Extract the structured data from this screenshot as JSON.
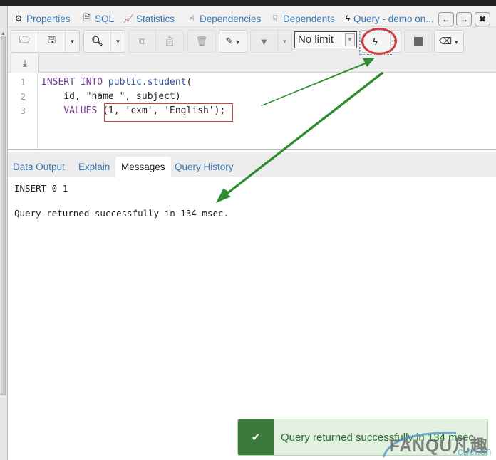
{
  "object_tabs": [
    {
      "label": "Properties",
      "icon": "gears-icon"
    },
    {
      "label": "SQL",
      "icon": "file-text-icon"
    },
    {
      "label": "Statistics",
      "icon": "line-chart-icon"
    },
    {
      "label": "Dependencies",
      "icon": "hand-up-icon"
    },
    {
      "label": "Dependents",
      "icon": "hand-down-icon"
    },
    {
      "label": "Query - demo on...",
      "icon": "bolt-icon"
    }
  ],
  "nav_buttons": {
    "back": "←",
    "forward": "→",
    "close": "✖"
  },
  "toolbar": {
    "open_file": "open-folder-icon",
    "save": "save-icon",
    "find": "search-icon",
    "copy": "copy-icon",
    "paste": "paste-icon",
    "delete": "trash-icon",
    "edit": "edit-icon",
    "filter": "filter-icon",
    "row_limit": "No limit",
    "execute": "bolt-icon",
    "stop": "stop-icon",
    "clear": "eraser-icon",
    "download": "download-icon"
  },
  "editor": {
    "line_numbers": [
      "1",
      "2",
      "3"
    ],
    "lines": {
      "l1_kw": "INSERT INTO ",
      "l1_obj": "public.student",
      "l1_rest": "(",
      "l2": "    id, \"name \", subject)",
      "l3_kw": "    VALUES ",
      "l3_rest": "(1, 'cxm', 'English');"
    }
  },
  "result_tabs": [
    {
      "label": "Data Output",
      "active": false
    },
    {
      "label": "Explain",
      "active": false
    },
    {
      "label": "Messages",
      "active": true
    },
    {
      "label": "Query History",
      "active": false
    }
  ],
  "messages": {
    "line1": "INSERT 0 1",
    "line2": "Query returned successfully in 134 msec."
  },
  "toast": {
    "text": "Query returned successfully in 134 msec.",
    "icon": "check-icon"
  },
  "watermark": {
    "main": "FANQU凡趣",
    "sub": "cuel.cn"
  },
  "annotation_colors": {
    "arrow": "#2e8b2e",
    "circle": "#d23c3c",
    "box": "#cc4444"
  }
}
